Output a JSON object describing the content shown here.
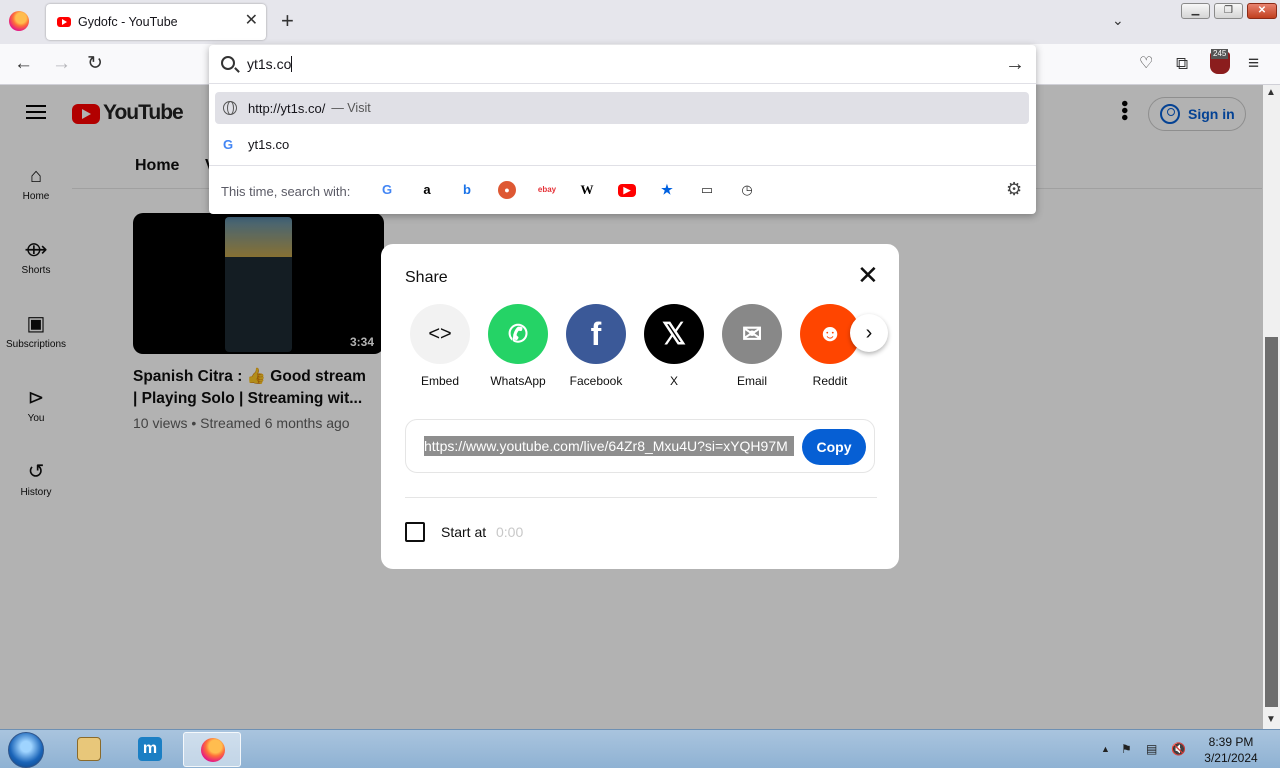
{
  "browser": {
    "tab_title": "Gydofc - YouTube",
    "url_input": "yt1s.co",
    "suggestions": [
      {
        "text": "http://yt1s.co/",
        "suffix": "— Visit",
        "icon": "globe-icon"
      },
      {
        "text": "yt1s.co",
        "suffix": "",
        "icon": "google-icon"
      }
    ],
    "search_with_label": "This time, search with:",
    "engines": [
      "google",
      "amazon",
      "bing",
      "duckduckgo",
      "ebay",
      "wikipedia",
      "youtube",
      "bookmarks",
      "tabs",
      "history"
    ],
    "extension_badge": "245"
  },
  "youtube": {
    "logo_text": "YouTube",
    "sign_in": "Sign in",
    "sidebar": [
      {
        "label": "Home",
        "icon": "home-icon"
      },
      {
        "label": "Shorts",
        "icon": "shorts-icon"
      },
      {
        "label": "Subscriptions",
        "icon": "subscriptions-icon"
      },
      {
        "label": "You",
        "icon": "you-icon"
      },
      {
        "label": "History",
        "icon": "history-icon"
      }
    ],
    "chips": [
      "Home",
      "V"
    ],
    "video": {
      "duration": "3:34",
      "title": "Spanish Citra : 👍 Good stream | Playing Solo | Streaming wit...",
      "meta": "10 views • Streamed 6 months ago"
    }
  },
  "share": {
    "title": "Share",
    "targets": [
      {
        "label": "Embed",
        "icon": "embed-icon",
        "color": "#f2f2f2"
      },
      {
        "label": "WhatsApp",
        "icon": "whatsapp-icon",
        "color": "#25d366"
      },
      {
        "label": "Facebook",
        "icon": "facebook-icon",
        "color": "#3b5998"
      },
      {
        "label": "X",
        "icon": "x-icon",
        "color": "#000000"
      },
      {
        "label": "Email",
        "icon": "email-icon",
        "color": "#888888"
      },
      {
        "label": "Reddit",
        "icon": "reddit-icon",
        "color": "#ff4500"
      }
    ],
    "link": "https://www.youtube.com/live/64Zr8_Mxu4U?si=xYQH97M",
    "copy_label": "Copy",
    "start_at_label": "Start at",
    "start_at_value": "0:00"
  },
  "taskbar": {
    "clock_time": "8:39 PM",
    "clock_date": "3/21/2024"
  }
}
